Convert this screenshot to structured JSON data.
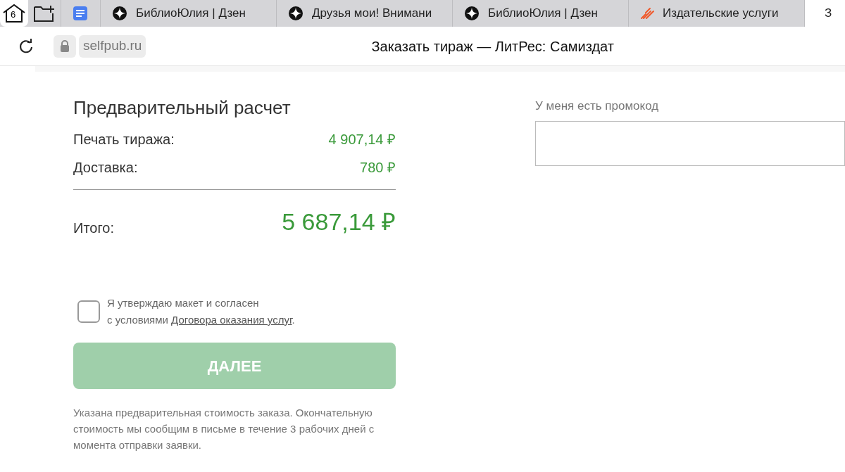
{
  "tab_bar": {
    "home_badge": "6",
    "tabs": [
      {
        "kind": "docs",
        "selected": false
      },
      {
        "kind": "zen",
        "title": "БиблиоЮлия | Дзен",
        "selected": false
      },
      {
        "kind": "zen",
        "title": "Друзья мои! Внимани",
        "selected": false
      },
      {
        "kind": "zen",
        "title": "БиблиоЮлия | Дзен",
        "selected": false
      },
      {
        "kind": "litres",
        "title": "Издательские услуги",
        "selected": false
      },
      {
        "kind": "litres",
        "title": "З",
        "selected": true
      }
    ]
  },
  "address_bar": {
    "url": "selfpub.ru",
    "page_title": "Заказать тираж — ЛитРес: Самиздат"
  },
  "estimate": {
    "heading": "Предварительный расчет",
    "lines": [
      {
        "label": "Печать тиража:",
        "value": "4 907,14 ₽"
      },
      {
        "label": "Доставка:",
        "value": "780 ₽"
      }
    ],
    "total_label": "Итого:",
    "total_value": "5 687,14 ₽"
  },
  "agreement": {
    "checked": false,
    "line1": "Я утверждаю макет и согласен",
    "prefix": "с условиями ",
    "link": "Договора оказания услуг",
    "suffix": "."
  },
  "next_button": {
    "label": "ДАЛЕЕ",
    "disabled": true
  },
  "note": "Указана предварительная стоимость заказа. Окончательную стоимость мы сообщим в письме в течение 3 рабочих дней с момента отправки заявки.",
  "promo": {
    "label": "У меня есть промокод"
  }
}
